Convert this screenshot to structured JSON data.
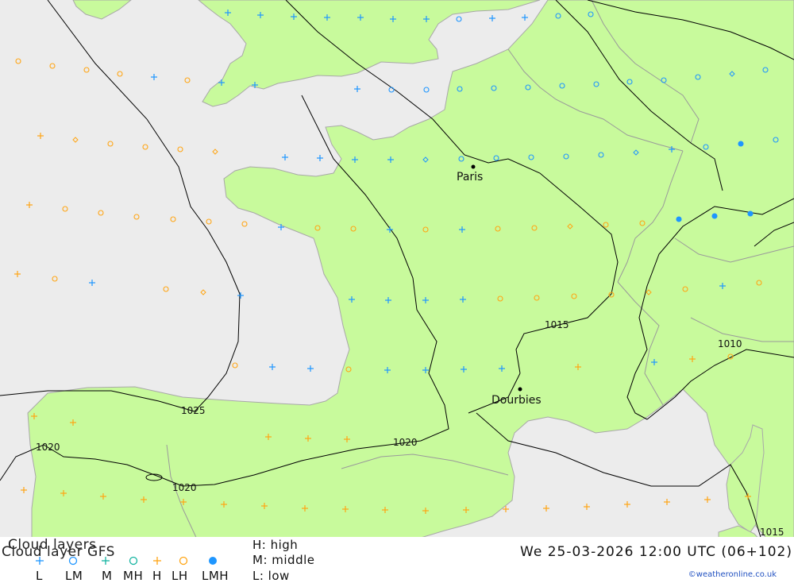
{
  "colors": {
    "sea": "#ececec",
    "land": "#c8fa9c",
    "border": "#999999",
    "isobar": "#000000",
    "cloud_low": "#1e96ff",
    "cloud_high": "#ffa514",
    "city": "#000000"
  },
  "map": {
    "cities": [
      {
        "name": "Paris",
        "type": "city"
      },
      {
        "name": "Dourbies",
        "type": "city"
      }
    ],
    "isobar_labels": [
      "1025",
      "1020",
      "1020",
      "1020",
      "1015",
      "1010",
      "1015"
    ]
  },
  "legend": {
    "title_overlap_1": "Cloud layers",
    "title_overlap_2": "Cloud layer   GFS",
    "symbol_labels": [
      "L",
      "LM",
      "M",
      "MH",
      "H",
      "LH",
      "LMH"
    ],
    "symbol_icons": [
      "plus-low-icon",
      "circle-low-icon",
      "plus-middle-icon",
      "circle-middle-icon",
      "plus-high-icon",
      "circle-high-icon",
      "dot-all-icon"
    ],
    "key_high": "H: high",
    "key_middle": "M: middle",
    "key_low": "L: low",
    "datetime": "We 25-03-2026 12:00 UTC (06+102)",
    "credit": "©weatheronline.co.uk"
  }
}
